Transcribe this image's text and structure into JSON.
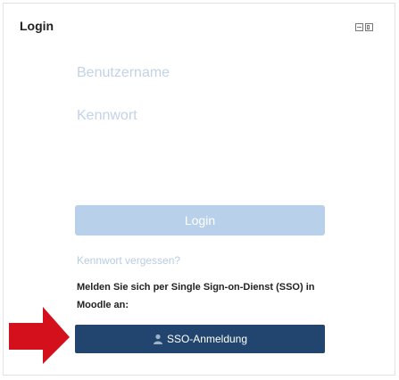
{
  "block": {
    "title": "Login",
    "controls": [
      "hide-icon",
      "dock-icon"
    ]
  },
  "form": {
    "username_placeholder": "Benutzername",
    "password_placeholder": "Kennwort",
    "login_label": "Login",
    "forgot_label": "Kennwort vergessen?",
    "sso_text": "Melden Sie sich per Single Sign-on-Dienst (SSO) in Moodle an:",
    "sso_label": "SSO-Anmeldung"
  },
  "colors": {
    "login_button": "#b8d0ea",
    "sso_button": "#21456e",
    "arrow": "#d4101d",
    "placeholder": "#c2d3e6"
  }
}
